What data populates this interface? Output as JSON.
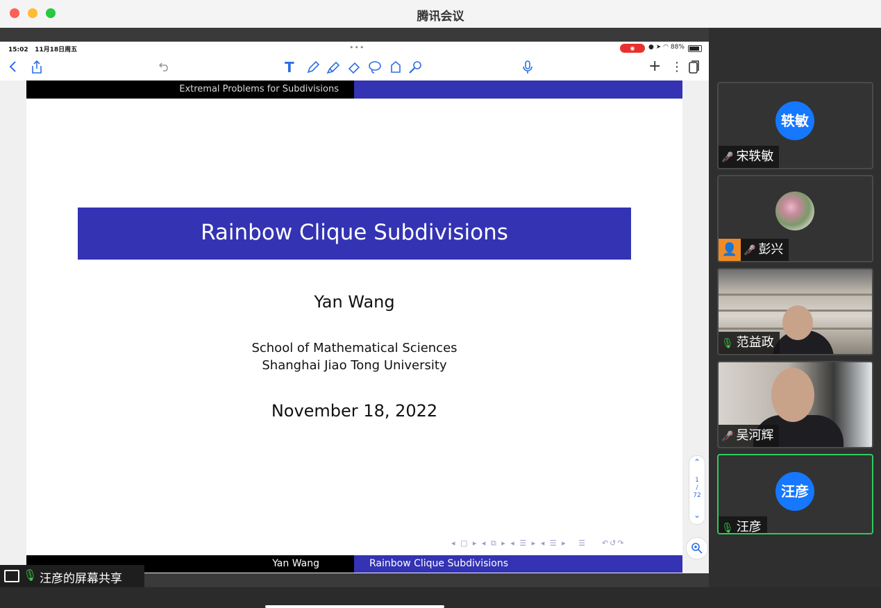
{
  "window": {
    "title": "腾讯会议"
  },
  "status_bar": {
    "time": "15:02",
    "date": "11月18日周五",
    "battery": "88%"
  },
  "toolbar": {
    "back_icon": "chevron-left-icon",
    "share_icon": "share-icon",
    "undo_icon": "undo-icon",
    "tools": [
      "text-tool-icon",
      "pen-icon",
      "highlighter-icon",
      "eraser-icon",
      "lasso-icon",
      "shape-icon",
      "laser-pointer-icon"
    ],
    "mic_icon": "microphone-icon",
    "add_label": "+",
    "more_label": "⋮"
  },
  "slide": {
    "header_left": "Extremal Problems for Subdivisions",
    "title": "Rainbow Clique Subdivisions",
    "author": "Yan Wang",
    "affiliation_line1": "School of Mathematical Sciences",
    "affiliation_line2": "Shanghai Jiao Tong University",
    "date": "November 18, 2022",
    "footer_left": "Yan Wang",
    "footer_right": "Rainbow Clique Subdivisions",
    "accent_color": "#3333b3"
  },
  "pager": {
    "current": "1",
    "separator": "/",
    "total": "72"
  },
  "screen_share": {
    "label": "汪彦的屏幕共享"
  },
  "participants": [
    {
      "name": "宋轶敏",
      "avatar_text": "轶敏",
      "mic": "muted"
    },
    {
      "name": "彭兴",
      "mic": "muted"
    },
    {
      "name": "范益政",
      "mic": "on"
    },
    {
      "name": "吴河辉",
      "mic": "muted"
    },
    {
      "name": "汪彦",
      "avatar_text": "汪彦",
      "mic": "on",
      "speaking": true
    }
  ]
}
